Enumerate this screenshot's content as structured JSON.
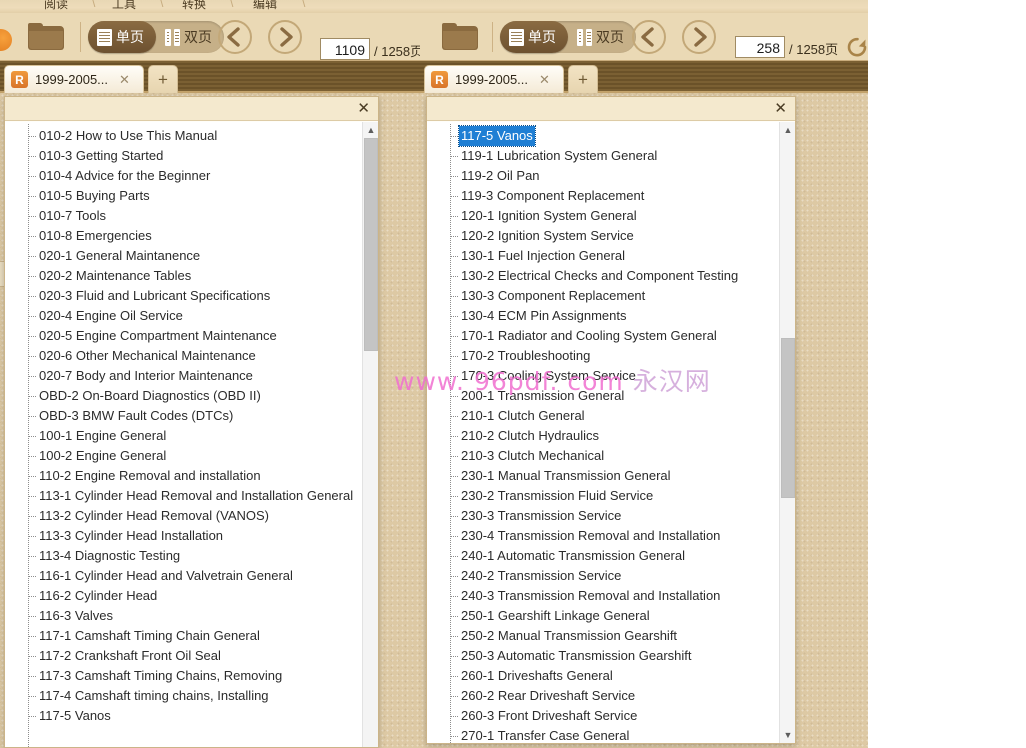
{
  "menu": {
    "items": [
      "阅读",
      "工具",
      "转换",
      "编辑"
    ]
  },
  "windows": {
    "left": {
      "toolbar": {
        "folder_icon": "folder-icon",
        "single_page_label": "单页",
        "double_page_label": "双页",
        "prev_icon": "arrow-left-icon",
        "next_icon": "arrow-right-icon",
        "page_value": "1109",
        "page_total": "/ 1258页"
      },
      "tab": {
        "title": "1999-2005...",
        "close_label": "✕",
        "favicon_label": "R",
        "newtab_label": "+"
      },
      "outline": {
        "close_label": "✕",
        "items": [
          {
            "label": "010-2 How to Use This Manual",
            "selected": false
          },
          {
            "label": "010-3 Getting Started",
            "selected": false
          },
          {
            "label": "010-4 Advice for the Beginner",
            "selected": false
          },
          {
            "label": "010-5 Buying Parts",
            "selected": false
          },
          {
            "label": "010-7 Tools",
            "selected": false
          },
          {
            "label": "010-8 Emergencies",
            "selected": false
          },
          {
            "label": "020-1 General Maintanence",
            "selected": false
          },
          {
            "label": "020-2 Maintenance Tables",
            "selected": false
          },
          {
            "label": "020-3 Fluid and Lubricant Specifications",
            "selected": false
          },
          {
            "label": "020-4 Engine Oil Service",
            "selected": false
          },
          {
            "label": "020-5 Engine Compartment Maintenance",
            "selected": false
          },
          {
            "label": "020-6 Other Mechanical Maintenance",
            "selected": false
          },
          {
            "label": "020-7 Body and Interior Maintenance",
            "selected": false
          },
          {
            "label": "OBD-2 On-Board Diagnostics (OBD II)",
            "selected": false
          },
          {
            "label": "OBD-3 BMW Fault Codes (DTCs)",
            "selected": false
          },
          {
            "label": "100-1 Engine General",
            "selected": false
          },
          {
            "label": "100-2 Engine General",
            "selected": false
          },
          {
            "label": "110-2 Engine Removal and installation",
            "selected": false
          },
          {
            "label": "113-1 Cylinder Head Removal and Installation General",
            "selected": false
          },
          {
            "label": "113-2 Cylinder Head Removal (VANOS)",
            "selected": false
          },
          {
            "label": "113-3 Cylinder Head Installation",
            "selected": false
          },
          {
            "label": "113-4 Diagnostic Testing",
            "selected": false
          },
          {
            "label": "116-1 Cylinder Head and Valvetrain General",
            "selected": false
          },
          {
            "label": "116-2 Cylinder Head",
            "selected": false
          },
          {
            "label": "116-3 Valves",
            "selected": false
          },
          {
            "label": "117-1 Camshaft Timing Chain General",
            "selected": false
          },
          {
            "label": "117-2 Crankshaft Front Oil Seal",
            "selected": false
          },
          {
            "label": "117-3 Camshaft Timing Chains, Removing",
            "selected": false
          },
          {
            "label": "117-4 Camshaft timing chains, Installing",
            "selected": false
          },
          {
            "label": "117-5 Vanos",
            "selected": false
          }
        ]
      }
    },
    "right": {
      "toolbar": {
        "folder_icon": "folder-icon",
        "single_page_label": "单页",
        "double_page_label": "双页",
        "prev_icon": "arrow-left-icon",
        "next_icon": "arrow-right-icon",
        "page_value": "258",
        "page_total": "/ 1258页",
        "reload_icon": "reload-icon"
      },
      "tab": {
        "title": "1999-2005...",
        "close_label": "✕",
        "favicon_label": "R",
        "newtab_label": "+"
      },
      "outline": {
        "close_label": "✕",
        "items": [
          {
            "label": "117-5 Vanos",
            "selected": true
          },
          {
            "label": "119-1 Lubrication System General",
            "selected": false
          },
          {
            "label": "119-2 Oil Pan",
            "selected": false
          },
          {
            "label": "119-3 Component Replacement",
            "selected": false
          },
          {
            "label": "120-1 Ignition System General",
            "selected": false
          },
          {
            "label": "120-2 Ignition System Service",
            "selected": false
          },
          {
            "label": "130-1 Fuel Injection General",
            "selected": false
          },
          {
            "label": "130-2 Electrical Checks and Component Testing",
            "selected": false
          },
          {
            "label": "130-3 Component Replacement",
            "selected": false
          },
          {
            "label": "130-4 ECM Pin Assignments",
            "selected": false
          },
          {
            "label": "170-1 Radiator and Cooling System General",
            "selected": false
          },
          {
            "label": "170-2 Troubleshooting",
            "selected": false
          },
          {
            "label": "170-3 Cooling System Service",
            "selected": false
          },
          {
            "label": "200-1 Transmission General",
            "selected": false
          },
          {
            "label": "210-1 Clutch General",
            "selected": false
          },
          {
            "label": "210-2 Clutch Hydraulics",
            "selected": false
          },
          {
            "label": "210-3 Clutch Mechanical",
            "selected": false
          },
          {
            "label": "230-1 Manual Transmission General",
            "selected": false
          },
          {
            "label": "230-2 Transmission Fluid Service",
            "selected": false
          },
          {
            "label": "230-3 Transmission Service",
            "selected": false
          },
          {
            "label": "230-4 Transmission Removal and Installation",
            "selected": false
          },
          {
            "label": "240-1 Automatic Transmission General",
            "selected": false
          },
          {
            "label": "240-2 Transmission Service",
            "selected": false
          },
          {
            "label": "240-3 Transmission Removal and Installation",
            "selected": false
          },
          {
            "label": "250-1 Gearshift Linkage General",
            "selected": false
          },
          {
            "label": "250-2 Manual Transmission Gearshift",
            "selected": false
          },
          {
            "label": "250-3 Automatic Transmission Gearshift",
            "selected": false
          },
          {
            "label": "260-1 Driveshafts General",
            "selected": false
          },
          {
            "label": "260-2 Rear Driveshaft Service",
            "selected": false
          },
          {
            "label": "260-3 Front Driveshaft Service",
            "selected": false
          },
          {
            "label": "270-1 Transfer Case General",
            "selected": false
          }
        ]
      }
    }
  },
  "watermark": {
    "url": "www. 96pdf. com",
    "cn": "永汉网"
  },
  "colors": {
    "accent": "#8a6b42",
    "toolbar_bg": "#ead9b5",
    "paper_bg": "#ddc9a4",
    "selection": "#1f7fd4",
    "watermark": "#f06fd0"
  }
}
